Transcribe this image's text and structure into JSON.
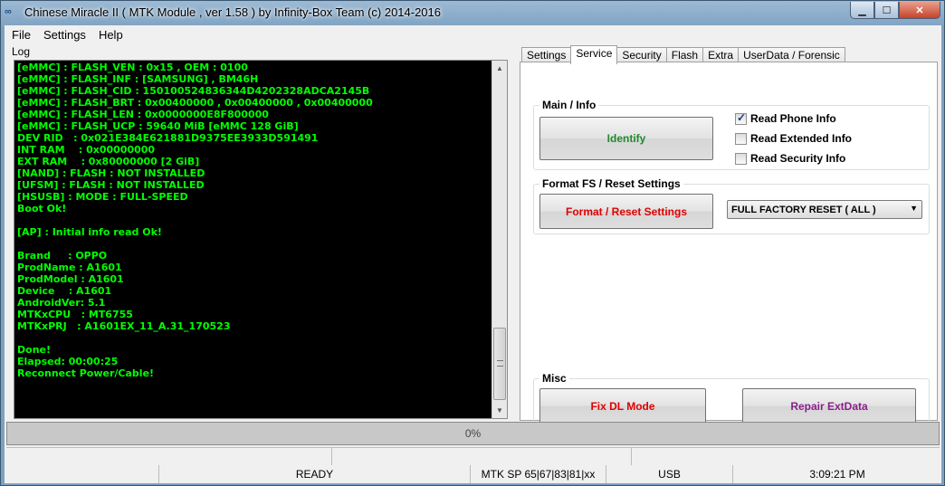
{
  "window": {
    "title": "Chinese Miracle II ( MTK Module , ver 1.58 ) by Infinity-Box Team (c) 2014-2016",
    "icon": "app-icon"
  },
  "menu": [
    "File",
    "Settings",
    "Help"
  ],
  "log": {
    "label": "Log",
    "lines": [
      "[eMMC] : FLASH_VEN : 0x15 , OEM : 0100",
      "[eMMC] : FLASH_INF : [SAMSUNG] , BM46H",
      "[eMMC] : FLASH_CID : 150100524836344D4202328ADCA2145B",
      "[eMMC] : FLASH_BRT : 0x00400000 , 0x00400000 , 0x00400000",
      "[eMMC] : FLASH_LEN : 0x0000000E8F800000",
      "[eMMC] : FLASH_UCP : 59640 MiB [eMMC 128 GiB]",
      "DEV RID   : 0x021E384E621881D9375EE3933D591491",
      "INT RAM    : 0x00000000",
      "EXT RAM    : 0x80000000 [2 GiB]",
      "[NAND] : FLASH : NOT INSTALLED",
      "[UFSM] : FLASH : NOT INSTALLED",
      "[HSUSB] : MODE : FULL-SPEED",
      "Boot Ok!",
      "",
      "[AP] : Initial info read Ok!",
      "",
      "Brand     : OPPO",
      "ProdName : A1601",
      "ProdModel : A1601",
      "Device    : A1601",
      "AndroidVer: 5.1",
      "MTKxCPU   : MT6755",
      "MTKxPRJ   : A1601EX_11_A.31_170523",
      "",
      "Done!",
      "Elapsed: 00:00:25",
      "Reconnect Power/Cable!"
    ]
  },
  "tabs": [
    "Settings",
    "Service",
    "Security",
    "Flash",
    "Extra",
    "UserData / Forensic"
  ],
  "active_tab": "Service",
  "service": {
    "main_info": {
      "title": "Main / Info",
      "identify_label": "Identify",
      "identify_color": "#1f8a2a",
      "checkboxes": [
        {
          "label": "Read Phone Info",
          "checked": true
        },
        {
          "label": "Read Extended Info",
          "checked": false
        },
        {
          "label": "Read Security Info",
          "checked": false
        }
      ]
    },
    "format": {
      "title": "Format FS / Reset Settings",
      "button_label": "Format / Reset Settings",
      "button_color": "#e00000",
      "selected_option": "FULL FACTORY RESET ( ALL )"
    },
    "misc": {
      "title": "Misc",
      "fix_dl_label": "Fix DL Mode",
      "fix_dl_color": "#e00000",
      "repair_label": "Repair ExtData",
      "repair_color": "#8a1f8a"
    }
  },
  "progress": {
    "text": "0%",
    "value": 0
  },
  "status": {
    "state": "READY",
    "mtk_sp": "MTK SP 65|67|83|81|xx",
    "port": "USB",
    "time": "3:09:21 PM"
  }
}
